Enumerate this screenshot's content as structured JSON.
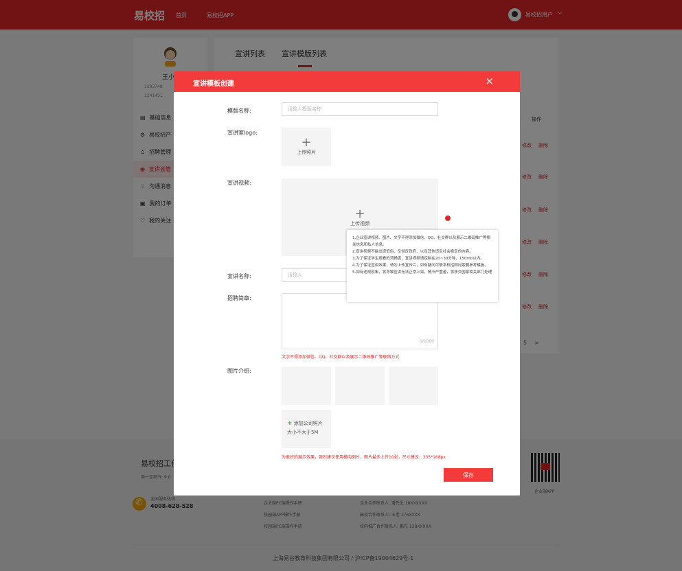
{
  "topbar": {
    "logo": "易校招",
    "nav": [
      "首页",
      "易校招APP"
    ],
    "user_label": "易校招用户",
    "user_chevron": "﹀"
  },
  "sidebar": {
    "name": "王小",
    "phone_line": "1283748",
    "email_line": "1241451",
    "items": [
      {
        "icon": "▤",
        "label": "基础信息"
      },
      {
        "icon": "⚙",
        "label": "易校招产"
      },
      {
        "icon": "♙",
        "label": "招聘管理"
      },
      {
        "icon": "◉",
        "label": "宣讲会管"
      },
      {
        "icon": "♤",
        "label": "沟通消息"
      },
      {
        "icon": "▣",
        "label": "我的订单"
      },
      {
        "icon": "♡",
        "label": "我的关注"
      }
    ]
  },
  "main": {
    "tabs": [
      "宣讲列表",
      "宣讲模版列表"
    ],
    "col_action": "操作",
    "row_edit": "修改",
    "row_delete": "删除",
    "pager_label": "5",
    "pager_next": ">"
  },
  "footer": {
    "title": "易校招工作",
    "hours": "周一至周五: 9:0",
    "service_label": "全国服务热线",
    "phone": "4008-628-528",
    "links": [
      "企业端PC端操作手册",
      "校园端APP操作手册",
      "校园端PC端操作手册"
    ],
    "contacts": [
      "企业合作联系人: 潘先生 18XXXXXX",
      "高校合作联系人: 王老 176XXXX",
      "校内推广合作联系人: 鹏先 138XXXXX"
    ],
    "qr_label": "企业端APP",
    "copyright": "上海易谷教育科技集团有限公司 / 沪ICP备19004629号-1"
  },
  "modal": {
    "title": "宣讲模板创建",
    "close": "×",
    "template_name_label": "模版名称:",
    "template_name_placeholder": "请输入模版名称",
    "logo_label": "宣讲室logo:",
    "upload_plus": "+",
    "upload_logo_text": "上传照片",
    "video_label": "宣讲视频:",
    "upload_video_text": "上传视频",
    "talk_name_label": "宣讲名称:",
    "talk_name_placeholder": "请输入",
    "brief_label": "招聘简章:",
    "counter": "0/1000",
    "brief_note": "文字不得添加微信、QQ、社交群以及展示二维码推广等联络方式",
    "images_label": "图片介绍:",
    "add_photo": "添加公司照片",
    "add_photo_plus": "+",
    "size_limit": "大小不大于5M",
    "images_note": "为更好的展示效果，强烈建议使用横向图片，图片最多上传10张，尺寸建议：335*168px",
    "save": "保存",
    "tooltip": [
      "1.企业宣讲视频、图片、文字不得添加微信、QQ、社交群以及展示二维码推广等相关信息和私人信息。",
      "2.宣讲视频不能出现低俗、反党反政府、以及其他违反社会稳定的内容。",
      "3.为了保证学生观看的流畅度，宣讲视频请控制在20~30分钟，150mb以内。",
      "4.为了保证宣讲效果，请勿上传宣传片，如有疑问可联系校招顾问索要参考模板。",
      "5.如有违规现象，将导致宣讲无法正常上架，情节严重者，将移交国家相关部门处理"
    ]
  }
}
